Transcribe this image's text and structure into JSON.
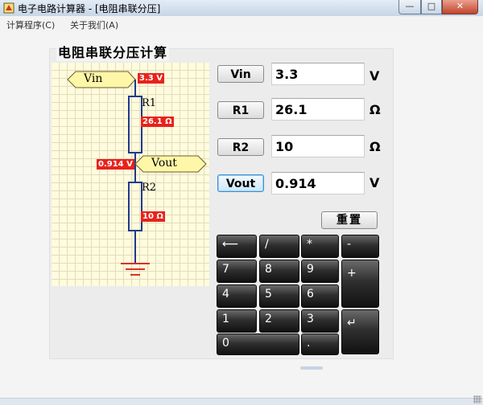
{
  "window": {
    "title": "电子电路计算器 - [电阻串联分压]",
    "buttons": {
      "minimize": "—",
      "maximize": "□",
      "close": "✕"
    }
  },
  "menu": {
    "items": [
      "计算程序(C)",
      "关于我们(A)"
    ]
  },
  "panel": {
    "title": "电阻串联分压计算"
  },
  "circuit": {
    "vin_tag": "Vin",
    "vout_tag": "Vout",
    "r1_name": "R1",
    "r2_name": "R2",
    "vin_value": "3.3 V",
    "r1_value": "26.1 Ω",
    "vout_value": "0.914 V",
    "r2_value": "10 Ω",
    "wire_color": "#1f3a8a",
    "label_color": "#e8221c"
  },
  "inputs": [
    {
      "label": "Vin",
      "value": "3.3",
      "unit": "V"
    },
    {
      "label": "R1",
      "value": "26.1",
      "unit": "Ω"
    },
    {
      "label": "R2",
      "value": "10",
      "unit": "Ω"
    },
    {
      "label": "Vout",
      "value": "0.914",
      "unit": "V"
    }
  ],
  "reset_label": "重置",
  "keypad": {
    "backspace": "⟵",
    "divide": "/",
    "multiply": "*",
    "minus": "-",
    "k7": "7",
    "k8": "8",
    "k9": "9",
    "plus": "+",
    "k4": "4",
    "k5": "5",
    "k6": "6",
    "k1": "1",
    "k2": "2",
    "k3": "3",
    "enter": "↵",
    "k0": "0",
    "dot": "."
  }
}
